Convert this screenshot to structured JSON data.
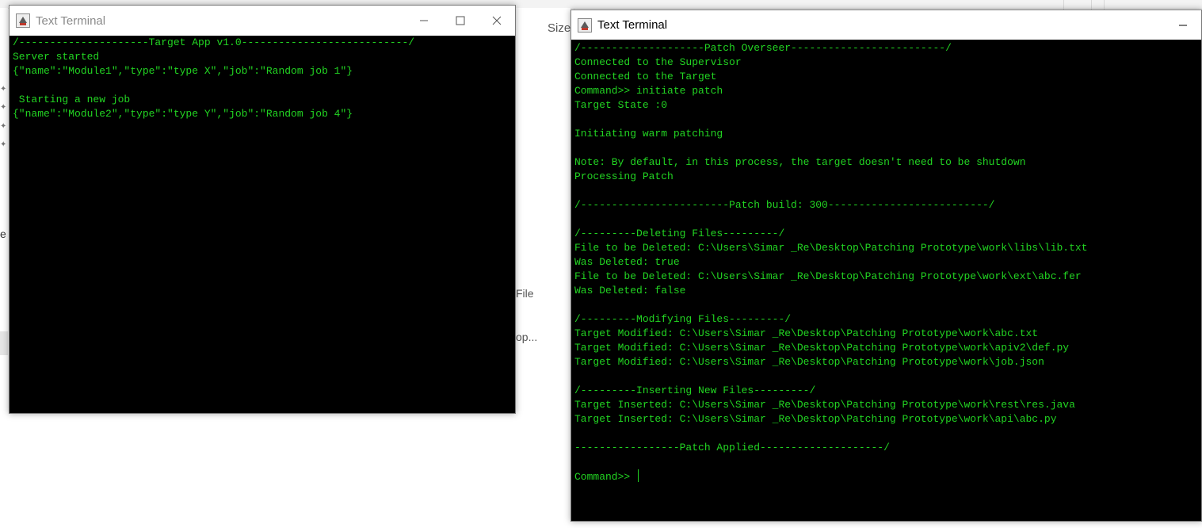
{
  "background": {
    "column_header": "Size",
    "file_label": "File",
    "truncated_label": "op...",
    "side_letter": "e"
  },
  "window_left": {
    "title": "Text Terminal",
    "icon": "java-coffee-icon",
    "lines": [
      "/---------------------Target App v1.0---------------------------/",
      "Server started",
      "{\"name\":\"Module1\",\"type\":\"type X\",\"job\":\"Random job 1\"}",
      "",
      " Starting a new job",
      "{\"name\":\"Module2\",\"type\":\"type Y\",\"job\":\"Random job 4\"}"
    ]
  },
  "window_right": {
    "title": "Text Terminal",
    "icon": "java-coffee-icon",
    "lines": [
      "/--------------------Patch Overseer-------------------------/",
      "Connected to the Supervisor",
      "Connected to the Target",
      "Command>> initiate patch",
      "Target State :0",
      "",
      "Initiating warm patching",
      "",
      "Note: By default, in this process, the target doesn't need to be shutdown",
      "Processing Patch",
      "",
      "/------------------------Patch build: 300--------------------------/",
      "",
      "/---------Deleting Files---------/",
      "File to be Deleted: C:\\Users\\Simar _Re\\Desktop\\Patching Prototype\\work\\libs\\lib.txt",
      "Was Deleted: true",
      "File to be Deleted: C:\\Users\\Simar _Re\\Desktop\\Patching Prototype\\work\\ext\\abc.fer",
      "Was Deleted: false",
      "",
      "/---------Modifying Files---------/",
      "Target Modified: C:\\Users\\Simar _Re\\Desktop\\Patching Prototype\\work\\abc.txt",
      "Target Modified: C:\\Users\\Simar _Re\\Desktop\\Patching Prototype\\work\\apiv2\\def.py",
      "Target Modified: C:\\Users\\Simar _Re\\Desktop\\Patching Prototype\\work\\job.json",
      "",
      "/---------Inserting New Files---------/",
      "Target Inserted: C:\\Users\\Simar _Re\\Desktop\\Patching Prototype\\work\\rest\\res.java",
      "Target Inserted: C:\\Users\\Simar _Re\\Desktop\\Patching Prototype\\work\\api\\abc.py",
      "",
      "-----------------Patch Applied--------------------/",
      ""
    ],
    "prompt": "Command>> "
  },
  "colors": {
    "console_bg": "#000000",
    "console_text": "#22d422",
    "titlebar_bg": "#ffffff"
  }
}
